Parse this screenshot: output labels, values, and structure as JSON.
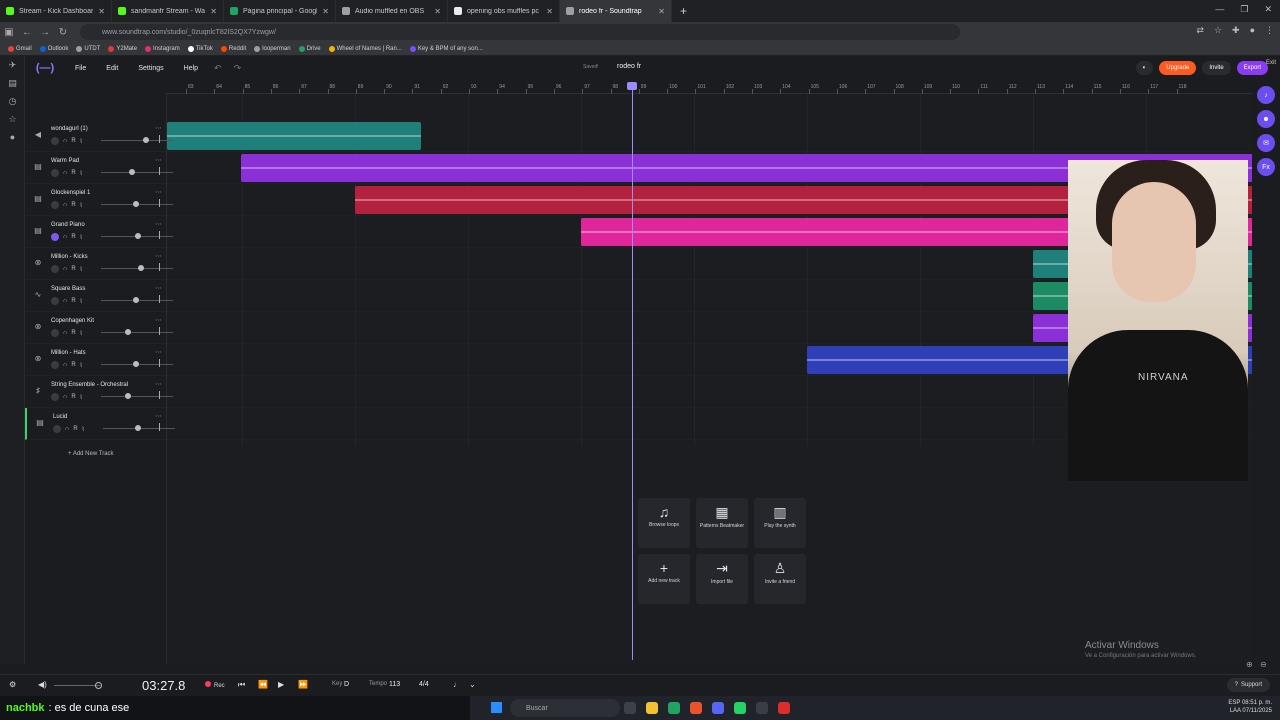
{
  "browser": {
    "tabs": [
      {
        "title": "Stream - Kick Dashboard",
        "color": "#53fc18"
      },
      {
        "title": "sandmanfr Stream - Watch Live",
        "color": "#53fc18"
      },
      {
        "title": "Página principal - Google Drive",
        "color": "#1fa463"
      },
      {
        "title": "Audio muffled en OBS",
        "color": "#9aa0a6"
      },
      {
        "title": "opening obs muffles pc audio",
        "color": "#e8eaed"
      },
      {
        "title": "rodeo fr - Soundtrap",
        "color": "#9aa0a6",
        "active": true
      }
    ],
    "url": "www.soundtrap.com/studio/_0zuqnlcT82lS2QX7Yzwgw/",
    "bookmarks": [
      {
        "label": "Gmail",
        "color": "#ea4335"
      },
      {
        "label": "Outlook",
        "color": "#0a64d8"
      },
      {
        "label": "UTDT",
        "color": "#9aa0a6"
      },
      {
        "label": "Y2Mate",
        "color": "#e53935"
      },
      {
        "label": "Instagram",
        "color": "#e1306c"
      },
      {
        "label": "TikTok",
        "color": "#ffffff"
      },
      {
        "label": "Reddit",
        "color": "#ff4500"
      },
      {
        "label": "looperman",
        "color": "#9aa0a6"
      },
      {
        "label": "Drive",
        "color": "#1fa463"
      },
      {
        "label": "Wheel of Names | Ran...",
        "color": "#f4b400"
      },
      {
        "label": "Key & BPM of any son...",
        "color": "#7c4dff"
      }
    ]
  },
  "app": {
    "menu": [
      "File",
      "Edit",
      "Settings",
      "Help"
    ],
    "saved_label": "Saved!",
    "project_title": "rodeo fr",
    "upgrade": "Upgrade",
    "invite": "Invite",
    "export": "Export",
    "exit": "Exit",
    "ruler_ticks": [
      "83",
      "84",
      "85",
      "86",
      "87",
      "88",
      "89",
      "90",
      "91",
      "92",
      "93",
      "94",
      "95",
      "96",
      "97",
      "98",
      "99",
      "100",
      "101",
      "102",
      "103",
      "104",
      "105",
      "106",
      "107",
      "108",
      "109",
      "110",
      "111",
      "112",
      "113",
      "114",
      "115",
      "116",
      "117",
      "118"
    ],
    "tracks": [
      {
        "name": "wondagurl (1)",
        "icon": "mic"
      },
      {
        "name": "Warm Pad",
        "icon": "keys"
      },
      {
        "name": "Glockenspiel 1",
        "icon": "keys"
      },
      {
        "name": "Grand Piano",
        "icon": "keys"
      },
      {
        "name": "Million - Kicks",
        "icon": "drum"
      },
      {
        "name": "Square Bass",
        "icon": "synth"
      },
      {
        "name": "Copenhagen Kit",
        "icon": "drum"
      },
      {
        "name": "Million - Hats",
        "icon": "drum"
      },
      {
        "name": "String Ensemble - Orchestral",
        "icon": "strings"
      },
      {
        "name": "Lucid",
        "icon": "keys"
      }
    ],
    "track_controls": {
      "r": "R"
    },
    "add_track": "Add New Track",
    "actions": [
      {
        "label": "Browse loops",
        "icon": "♫"
      },
      {
        "label": "Patterns Beatmaker",
        "icon": "▦"
      },
      {
        "label": "Play the synth",
        "icon": "▥"
      },
      {
        "label": "Add new track",
        "icon": "+"
      },
      {
        "label": "Import file",
        "icon": "⇥"
      },
      {
        "label": "Invite a friend",
        "icon": "♙"
      }
    ],
    "activate_title": "Activar Windows",
    "activate_sub": "Ve a Configuración para activar Windows.",
    "transport": {
      "time": "03:27.8",
      "rec": "Rec",
      "key_label": "Key",
      "key_value": "D",
      "tempo_label": "Tempo",
      "tempo_value": "113",
      "signature": "4/4",
      "support": "Support"
    },
    "clip_colors": {
      "teal": "#1f7f7a",
      "purple": "#8b2fd6",
      "red": "#b3213f",
      "pink": "#e0269b",
      "blue": "#2e3fb8",
      "green": "#1c8a63"
    }
  },
  "webcam": {
    "shirt_print": "NIRVANA"
  },
  "taskbar": {
    "chat_user": "nachbk",
    "chat_message": ": es de cuna ese",
    "search": "Buscar",
    "lang": "ESP",
    "region": "LAA",
    "clock": "08:51 p. m.",
    "date": "07/11/2025"
  }
}
